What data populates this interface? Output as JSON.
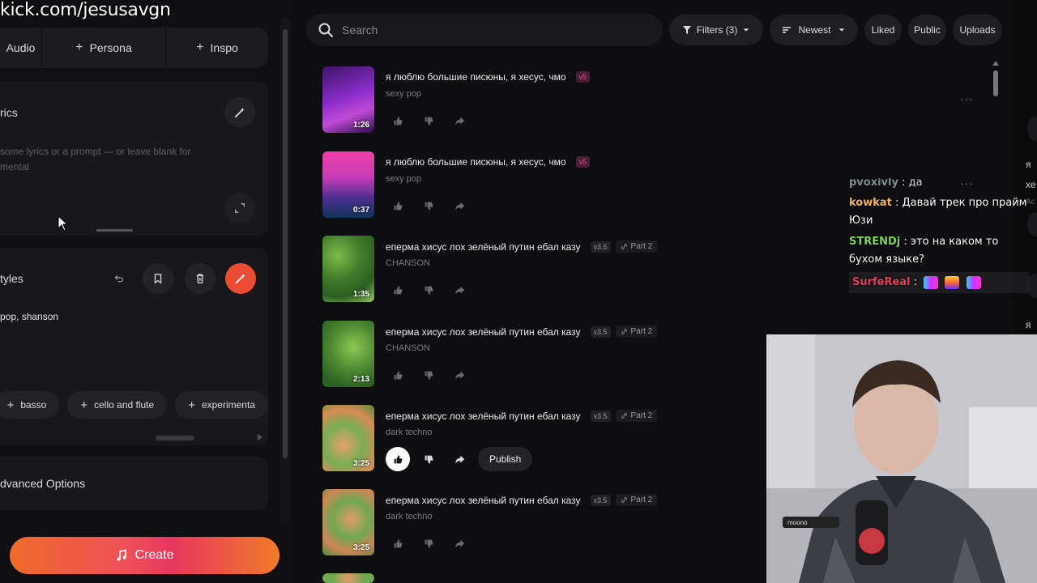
{
  "watermark": "kick.com/jesusavgn",
  "left": {
    "tabs": [
      {
        "label": "Audio",
        "plus": false
      },
      {
        "label": "Persona",
        "plus": true
      },
      {
        "label": "Inspo",
        "plus": true
      }
    ],
    "lyrics": {
      "title": "rics",
      "placeholder_line1": "some lyrics or a prompt — or leave blank for",
      "placeholder_line2": "mental"
    },
    "styles": {
      "title": "tyles",
      "value": "pop, shanson",
      "tags": [
        "basso",
        "cello and flute",
        "experimenta"
      ]
    },
    "advanced": "dvanced Options",
    "create_label": "Create"
  },
  "toolbar": {
    "search_placeholder": "Search",
    "filters": "Filters (3)",
    "sort": "Newest",
    "liked": "Liked",
    "public": "Public",
    "uploads": "Uploads"
  },
  "songs": [
    {
      "title": "я люблю большие писюны, я хесус, чмо",
      "version": "v5",
      "part": "",
      "style": "sexy pop",
      "duration": "1:26",
      "liked": false
    },
    {
      "title": "я люблю большие писюны, я хесус, чмо",
      "version": "v5",
      "part": "",
      "style": "sexy pop",
      "duration": "0:37",
      "liked": false
    },
    {
      "title": "еперма хисус лох зелёный путин ебал казу",
      "version": "v3.5",
      "part": "Part 2",
      "style": "CHANSON",
      "duration": "1:35",
      "liked": false
    },
    {
      "title": "еперма хисус лох зелёный путин ебал казу",
      "version": "v3.5",
      "part": "Part 2",
      "style": "CHANSON",
      "duration": "2:13",
      "liked": false
    },
    {
      "title": "еперма хисус лох зелёный путин ебал казу",
      "version": "v3.5",
      "part": "Part 2",
      "style": "dark techno",
      "duration": "3:25",
      "liked": true
    },
    {
      "title": "еперма хисус лох зелёный путин ебал казу",
      "version": "v3.5",
      "part": "Part 2",
      "style": "dark techno",
      "duration": "3:25",
      "liked": false
    }
  ],
  "publish_label": "Publish",
  "more_label": "···",
  "chat": [
    {
      "user": "pvoxivly",
      "text": ": да",
      "color": "#9aa0a6"
    },
    {
      "user": "kowkat",
      "text": ": Давай трек про прайм Юзи",
      "color": "#f0b35a"
    },
    {
      "user": "STRENDj",
      "text": ": это на каком то бухом языке?",
      "color": "#7bd35a"
    },
    {
      "user": "SurfeReal",
      "text": ":",
      "color": "#e0405a"
    }
  ],
  "right_strip": [
    "я",
    "хе",
    "Ac",
    "я"
  ],
  "cam_label": "moono"
}
